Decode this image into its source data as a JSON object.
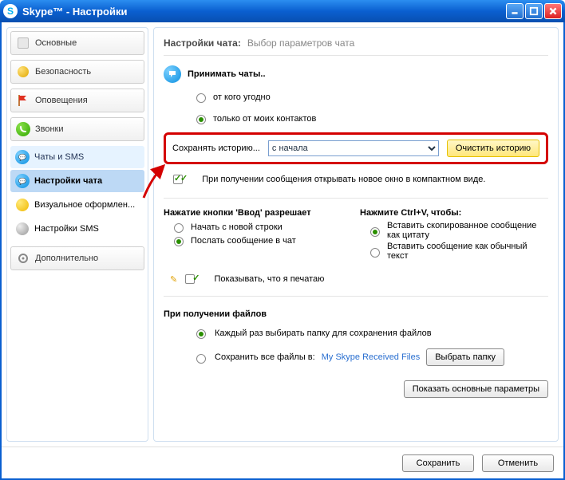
{
  "window": {
    "title": "Skype™ - Настройки"
  },
  "sidebar": {
    "items": [
      {
        "label": "Основные",
        "icon": "basic"
      },
      {
        "label": "Безопасность",
        "icon": "lock"
      },
      {
        "label": "Оповещения",
        "icon": "flag"
      },
      {
        "label": "Звонки",
        "icon": "phone"
      },
      {
        "label": "Чаты и SMS",
        "icon": "chat",
        "expanded": true,
        "children": [
          {
            "label": "Настройки чата",
            "icon": "chat",
            "active": true
          },
          {
            "label": "Визуальное оформлен...",
            "icon": "smile"
          },
          {
            "label": "Настройки SMS",
            "icon": "sms"
          }
        ]
      },
      {
        "label": "Дополнительно",
        "icon": "gear"
      }
    ]
  },
  "header": {
    "title": "Настройки чата:",
    "desc": "Выбор параметров чата"
  },
  "accept_chats": {
    "title": "Принимать чаты..",
    "anyone": "от кого угодно",
    "contacts": "только от моих контактов",
    "selected": "contacts"
  },
  "history": {
    "label": "Сохранять историю...",
    "value": "с начала",
    "clear_btn": "Очистить историю"
  },
  "open_compact": "При получении сообщения открывать новое окно в компактном виде.",
  "enter_key": {
    "title": "Нажатие кнопки 'Ввод' разрешает",
    "newline": "Начать с новой строки",
    "send": "Послать сообщение в чат",
    "selected": "send"
  },
  "ctrl_v": {
    "title": "Нажмите Ctrl+V, чтобы:",
    "quote": "Вставить скопированное сообщение как цитату",
    "plain": "Вставить сообщение как обычный текст",
    "selected": "quote"
  },
  "typing_indicator": "Показывать, что я печатаю",
  "files": {
    "title": "При получении файлов",
    "ask": "Каждый раз выбирать папку для сохранения файлов",
    "save_to": "Сохранить все файлы в:",
    "folder": "My Skype Received Files",
    "choose_btn": "Выбрать папку",
    "selected": "ask"
  },
  "show_basic_btn": "Показать основные параметры",
  "footer": {
    "save": "Сохранить",
    "cancel": "Отменить"
  }
}
